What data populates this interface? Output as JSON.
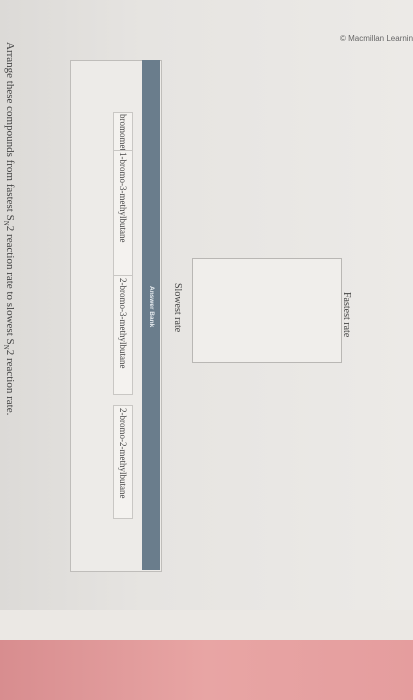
{
  "header": {
    "copyright": "© Macmillan Learning"
  },
  "question": {
    "prefix": "Arrange these compounds from fastest S",
    "sub1": "N",
    "middle": "2 reaction rate to slowest S",
    "sub2": "N",
    "suffix": "2 reaction rate."
  },
  "ranking": {
    "fastest_label": "Fastest rate",
    "slowest_label": "Slowest rate"
  },
  "answer_bank": {
    "title": "Answer Bank",
    "items": [
      {
        "label": "bromomethane"
      },
      {
        "label": "1-bromo-3-methylbutane"
      },
      {
        "label": "2-bromo-3-methylbutane"
      },
      {
        "label": "2-bromo-2-methylbutane"
      }
    ]
  }
}
